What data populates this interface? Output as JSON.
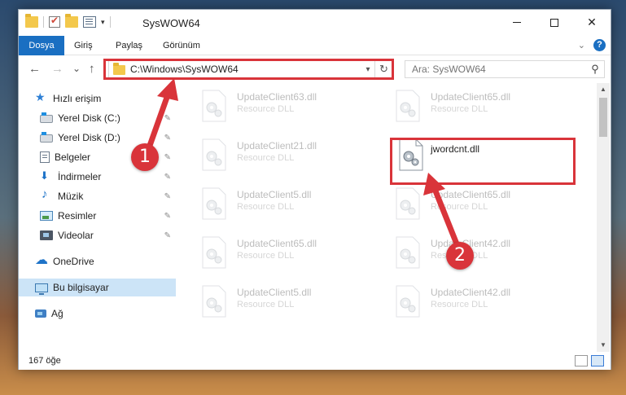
{
  "window": {
    "title": "SysWOW64",
    "minimize_symbol": "",
    "close_symbol": "✕"
  },
  "ribbon": {
    "tabs": [
      "Dosya",
      "Giriş",
      "Paylaş",
      "Görünüm"
    ],
    "help": "?"
  },
  "nav": {
    "back": "←",
    "forward": "→",
    "recent": "⌄",
    "up": "↑",
    "address": "C:\\Windows\\SysWOW64",
    "refresh": "↻",
    "search_placeholder": "Ara: SysWOW64",
    "search_icon": "⚲"
  },
  "sidebar": {
    "items": [
      {
        "label": "Hızlı erişim",
        "icon": "star-icon"
      },
      {
        "label": "Yerel Disk (C:)",
        "icon": "disk-icon"
      },
      {
        "label": "Yerel Disk (D:)",
        "icon": "disk-icon"
      },
      {
        "label": "Belgeler",
        "icon": "document-icon"
      },
      {
        "label": "İndirmeler",
        "icon": "download-icon"
      },
      {
        "label": "Müzik",
        "icon": "music-icon"
      },
      {
        "label": "Resimler",
        "icon": "pictures-icon"
      },
      {
        "label": "Videolar",
        "icon": "video-icon"
      },
      {
        "label": "OneDrive",
        "icon": "cloud-icon"
      },
      {
        "label": "Bu bilgisayar",
        "icon": "computer-icon"
      },
      {
        "label": "Ağ",
        "icon": "network-icon"
      }
    ],
    "pin_symbol": "📌"
  },
  "files": [
    {
      "name": "UpdateClient63.dll",
      "type": "Resource DLL"
    },
    {
      "name": "UpdateClient65.dll",
      "type": "Resource DLL"
    },
    {
      "name": "UpdateClient21.dll",
      "type": "Resource DLL"
    },
    {
      "name": "jwordcnt.dll",
      "type": ""
    },
    {
      "name": "UpdateClient5.dll",
      "type": "Resource DLL"
    },
    {
      "name": "UpdateClient65.dll",
      "type": "Resource DLL"
    },
    {
      "name": "UpdateClient65.dll",
      "type": "Resource DLL"
    },
    {
      "name": "UpdateClient42.dll",
      "type": "Resource DLL"
    },
    {
      "name": "UpdateClient5.dll",
      "type": "Resource DLL"
    },
    {
      "name": "UpdateClient42.dll",
      "type": "Resource DLL"
    }
  ],
  "status": {
    "item_count": "167 öğe"
  },
  "annotations": {
    "step1": "1",
    "step2": "2",
    "color": "#d9343a"
  }
}
